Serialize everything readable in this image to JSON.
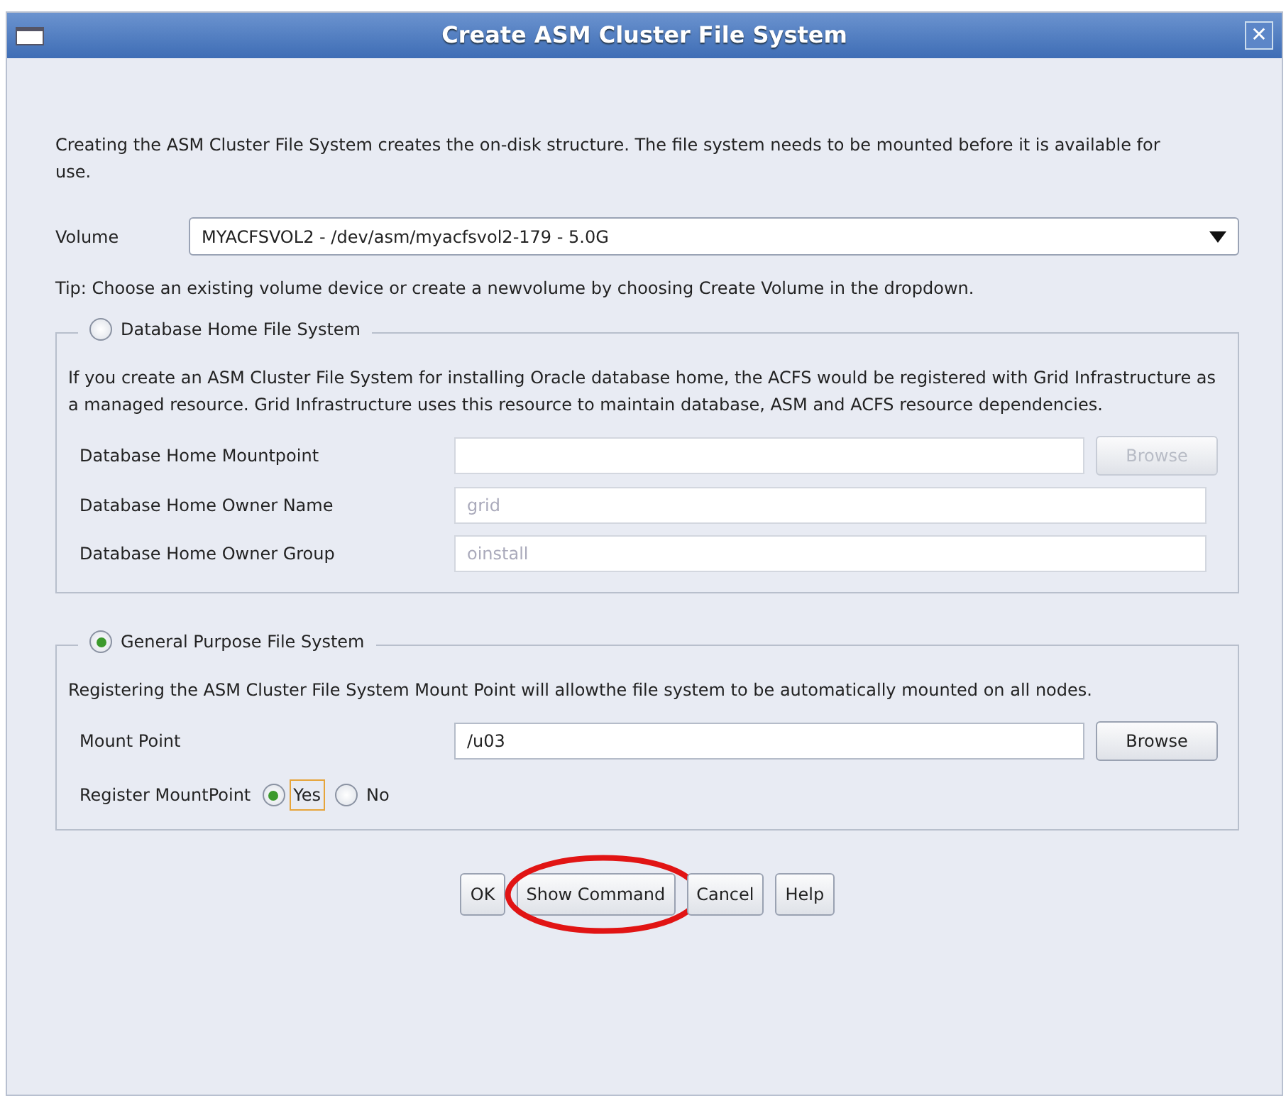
{
  "window": {
    "title": "Create ASM Cluster File System",
    "close": "✕"
  },
  "intro": "Creating the ASM Cluster File System creates the on-disk structure. The file system needs to be mounted before it is available for use.",
  "volume": {
    "label": "Volume",
    "value": "MYACFSVOL2 - /dev/asm/myacfsvol2-179 - 5.0G"
  },
  "tip": "Tip: Choose an existing volume device or create a newvolume by choosing Create Volume in the dropdown.",
  "sections": [
    {
      "title": "Database Home File System",
      "selected": false,
      "description": "If you create an ASM Cluster File System for installing Oracle database home, the ACFS would be registered with Grid Infrastructure as a managed resource. Grid Infrastructure uses this resource to maintain database, ASM and ACFS resource dependencies.",
      "fields": [
        {
          "label": "Database Home Mountpoint",
          "disabled": true,
          "button": "Browse"
        },
        {
          "label": "Database Home Owner Name",
          "value": "grid",
          "disabled": true
        },
        {
          "label": "Database Home Owner Group",
          "value": "oinstall",
          "disabled": true
        }
      ]
    },
    {
      "title": "General Purpose File System",
      "selected": true,
      "description": "Registering the ASM Cluster File System Mount Point will allowthe file system to be automatically mounted on all nodes.",
      "fields": [
        {
          "label": "Mount Point",
          "value": "/u03",
          "disabled": false,
          "button": "Browse"
        }
      ],
      "register": {
        "label": "Register MountPoint",
        "options": [
          {
            "label": "Yes",
            "selected": true
          },
          {
            "label": "No",
            "selected": false
          }
        ]
      }
    }
  ],
  "buttons": [
    {
      "label": "OK",
      "highlighted": false
    },
    {
      "label": "Show Command",
      "highlighted": true
    },
    {
      "label": "Cancel",
      "highlighted": false
    },
    {
      "label": "Help",
      "highlighted": false
    }
  ]
}
